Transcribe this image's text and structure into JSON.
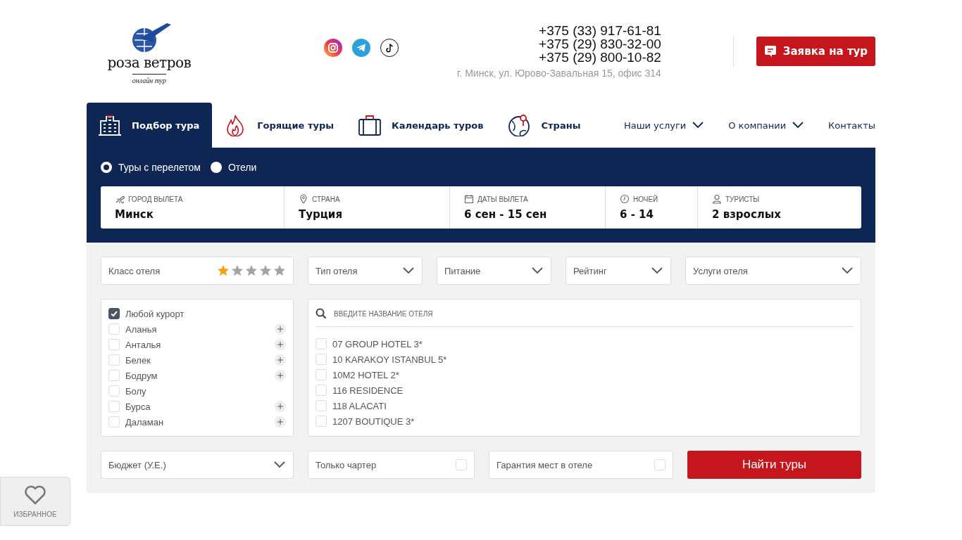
{
  "header": {
    "logo": {
      "name": "роза ветров",
      "tagline": "онлайн тур"
    },
    "phones": [
      "+375 (33) 917-61-81",
      "+375 (29) 830-32-00",
      "+375 (29) 800-10-82"
    ],
    "address": "г. Минск, ул. Юрово-Завальная 15, офис 314",
    "request_button": "Заявка на тур"
  },
  "nav": {
    "tabs": [
      {
        "label": "Подбор тура",
        "selected": true
      },
      {
        "label": "Горящие туры",
        "selected": false
      },
      {
        "label": "Календарь туров",
        "selected": false
      },
      {
        "label": "Страны",
        "selected": false
      }
    ],
    "links": [
      {
        "label": "Наши услуги",
        "kind": "dropdown"
      },
      {
        "label": "О компании",
        "kind": "dropdown"
      },
      {
        "label": "Контакты",
        "kind": "link"
      }
    ]
  },
  "search": {
    "modes": [
      {
        "label": "Туры с перелетом",
        "selected": true
      },
      {
        "label": "Отели",
        "selected": false
      }
    ],
    "fields": [
      {
        "label": "ГОРОД ВЫЛЕТА",
        "value": "Минск"
      },
      {
        "label": "СТРАНА",
        "value": "Турция"
      },
      {
        "label": "ДАТЫ ВЫЛЕТА",
        "value": "6 сен - 15 сен"
      },
      {
        "label": "НОЧЕЙ",
        "value": "6 - 14"
      },
      {
        "label": "ТУРИСТЫ",
        "value": "2 взрослых"
      }
    ]
  },
  "filters": {
    "hotel_class": {
      "label": "Класс отеля",
      "stars": 1
    },
    "dropdowns": [
      "Тип отеля",
      "Питание",
      "Рейтинг",
      "Услуги отеля"
    ],
    "resorts": [
      {
        "label": "Любой курорт",
        "checked": true,
        "expandable": false
      },
      {
        "label": "Аланья",
        "checked": false,
        "expandable": true
      },
      {
        "label": "Анталья",
        "checked": false,
        "expandable": true
      },
      {
        "label": "Белек",
        "checked": false,
        "expandable": true
      },
      {
        "label": "Бодрум",
        "checked": false,
        "expandable": true
      },
      {
        "label": "Болу",
        "checked": false,
        "expandable": false
      },
      {
        "label": "Бурса",
        "checked": false,
        "expandable": true
      },
      {
        "label": "Даламан",
        "checked": false,
        "expandable": true
      }
    ],
    "hotel_search": {
      "placeholder": "ВВЕДИТЕ НАЗВАНИЕ ОТЕЛЯ"
    },
    "hotels": [
      {
        "label": "07 GROUP HOTEL 3*",
        "checked": false
      },
      {
        "label": "10 KARAKOY ISTANBUL 5*",
        "checked": false
      },
      {
        "label": "10M2 HOTEL 2*",
        "checked": false
      },
      {
        "label": "116 RESIDENCE",
        "checked": false
      },
      {
        "label": "118 ALACATI",
        "checked": false
      },
      {
        "label": "1207 BOUTIQUE 3*",
        "checked": false
      }
    ],
    "budget": "Бюджет (У.Е.)",
    "options": [
      {
        "label": "Только чартер",
        "checked": false
      },
      {
        "label": "Гарантия мест в отеле",
        "checked": false
      }
    ],
    "submit": "Найти туры"
  },
  "favorites": {
    "label": "ИЗБРАННОЕ"
  }
}
